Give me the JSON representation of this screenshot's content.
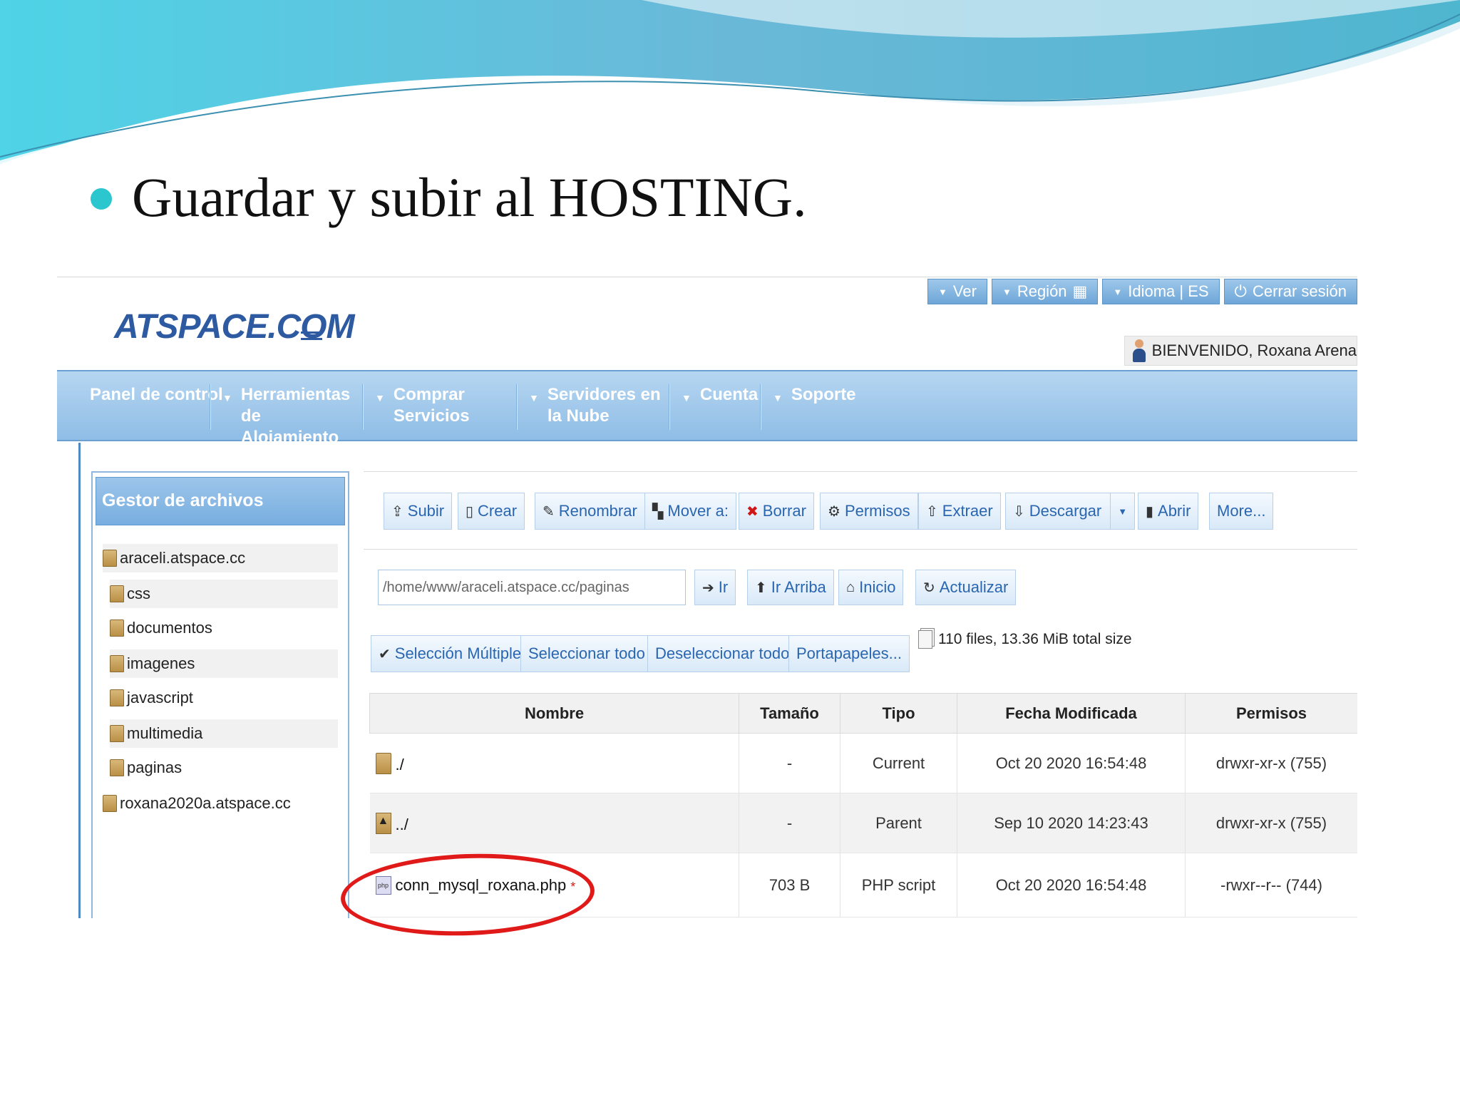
{
  "slide": {
    "title": "Guardar y subir al HOSTING.",
    "accent_color": "#2cc6cf"
  },
  "site": {
    "logo": "ATSPACE.COM",
    "top_links": [
      {
        "label": "Ver"
      },
      {
        "label": "Región"
      },
      {
        "label": "Idioma | ES"
      },
      {
        "label": "Cerrar sesión"
      }
    ],
    "welcome": "BIENVENIDO, Roxana Arena",
    "nav": [
      {
        "label": "Panel de control"
      },
      {
        "label": "Herramientas de Alojamiento"
      },
      {
        "label": "Comprar Servicios"
      },
      {
        "label": "Servidores en la Nube"
      },
      {
        "label": "Cuenta"
      },
      {
        "label": "Soporte"
      }
    ]
  },
  "file_manager": {
    "panel_title": "Gestor de archivos",
    "tree": [
      {
        "label": "araceli.atspace.cc"
      },
      {
        "label": "css"
      },
      {
        "label": "documentos"
      },
      {
        "label": "imagenes"
      },
      {
        "label": "javascript"
      },
      {
        "label": "multimedia"
      },
      {
        "label": "paginas"
      },
      {
        "label": "roxana2020a.atspace.cc"
      }
    ],
    "toolbar": {
      "subir": "Subir",
      "crear": "Crear",
      "renombrar": "Renombrar",
      "mover": "Mover a:",
      "borrar": "Borrar",
      "permisos": "Permisos",
      "extraer": "Extraer",
      "descargar": "Descargar",
      "abrir": "Abrir",
      "more": "More..."
    },
    "path": {
      "value": "/home/www/araceli.atspace.cc/paginas",
      "ir": "Ir",
      "ir_arriba": "Ir Arriba",
      "inicio": "Inicio",
      "actualizar": "Actualizar"
    },
    "selection": {
      "multiple": "Selección Múltiple",
      "select_all": "Seleccionar todo",
      "deselect_all": "Deseleccionar todo",
      "clipboard": "Portapapeles..."
    },
    "stats": "110 files, 13.36 MiB total size",
    "columns": [
      "Nombre",
      "Tamaño",
      "Tipo",
      "Fecha Modificada",
      "Permisos"
    ],
    "rows": [
      {
        "name": "./",
        "size": "-",
        "type": "Current",
        "modified": "Oct 20 2020 16:54:48",
        "perms": "drwxr-xr-x (755)"
      },
      {
        "name": "../",
        "size": "-",
        "type": "Parent",
        "modified": "Sep 10 2020 14:23:43",
        "perms": "drwxr-xr-x (755)"
      },
      {
        "name": "conn_mysql_roxana.php",
        "marker": "*",
        "size": "703 B",
        "type": "PHP script",
        "modified": "Oct 20 2020 16:54:48",
        "perms": "-rwxr--r-- (744)"
      }
    ]
  }
}
